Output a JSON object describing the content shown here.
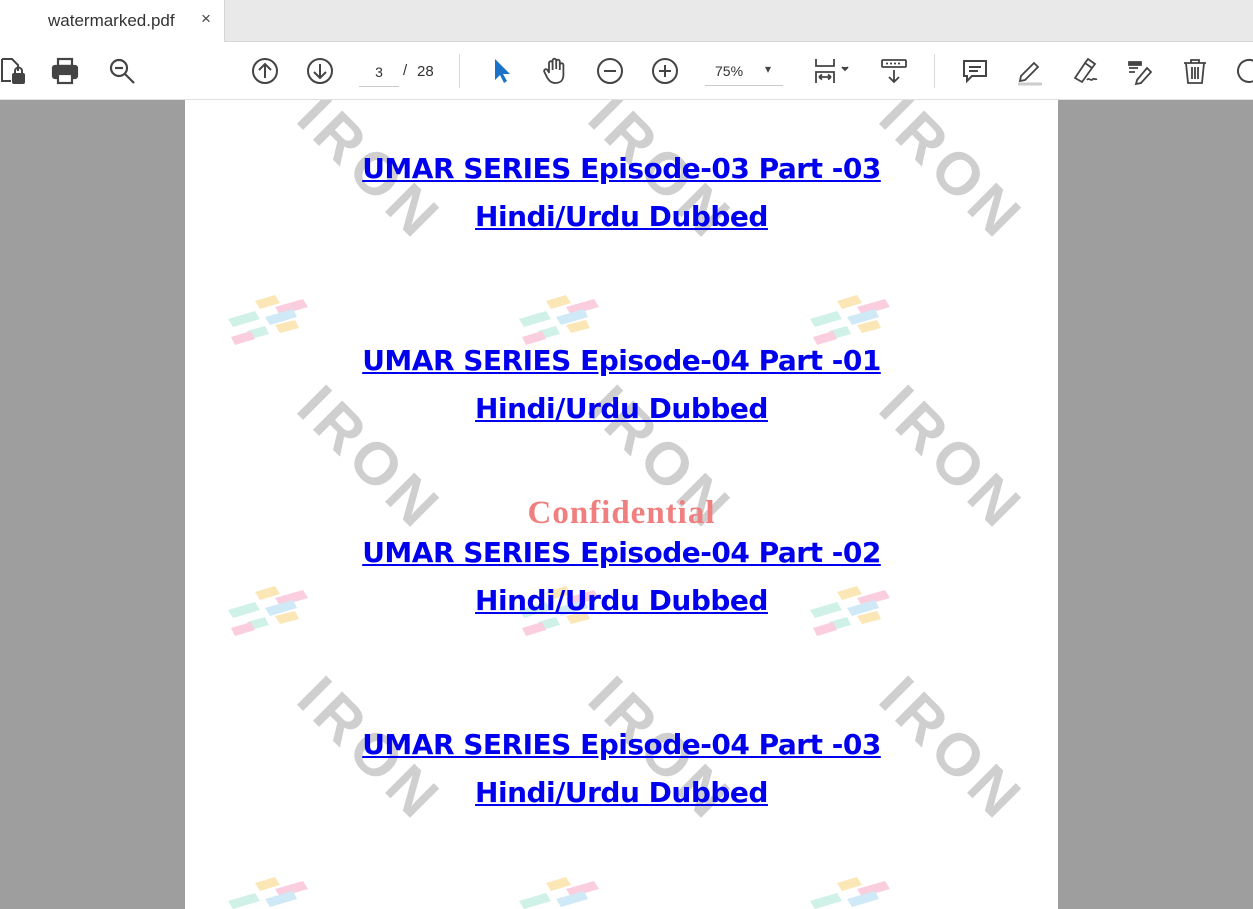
{
  "tab": {
    "title": "watermarked.pdf",
    "close_glyph": "×"
  },
  "toolbar": {
    "page_current": "3",
    "page_separator": "/",
    "page_total": "28",
    "zoom": "75%",
    "zoom_caret": "▾",
    "icons": [
      "lock-document-icon",
      "print-icon",
      "search-icon",
      "page-up-icon",
      "page-down-icon",
      "cursor-icon",
      "hand-icon",
      "zoom-out-icon",
      "zoom-in-icon",
      "fit-page-icon",
      "scroll-mode-icon",
      "comment-icon",
      "highlight-icon",
      "draw-icon",
      "fill-sign-icon",
      "delete-icon",
      "rotate-icon"
    ]
  },
  "document": {
    "watermark_text": "IRON",
    "confidential": "Confidential",
    "links": [
      {
        "line1": "UMAR SERIES Episode-03 Part -03",
        "line2": "Hindi/Urdu Dubbed"
      },
      {
        "line1": "UMAR SERIES Episode-04 Part -01",
        "line2": "Hindi/Urdu Dubbed"
      },
      {
        "line1": "UMAR SERIES Episode-04 Part -02",
        "line2": "Hindi/Urdu Dubbed"
      },
      {
        "line1": "UMAR SERIES Episode-04 Part -03",
        "line2": "Hindi/Urdu Dubbed"
      }
    ]
  },
  "colors": {
    "link": "#0000ee",
    "confidential": "#f08080",
    "viewer_bg": "#9e9e9e",
    "watermark": "#cfcfcf"
  }
}
